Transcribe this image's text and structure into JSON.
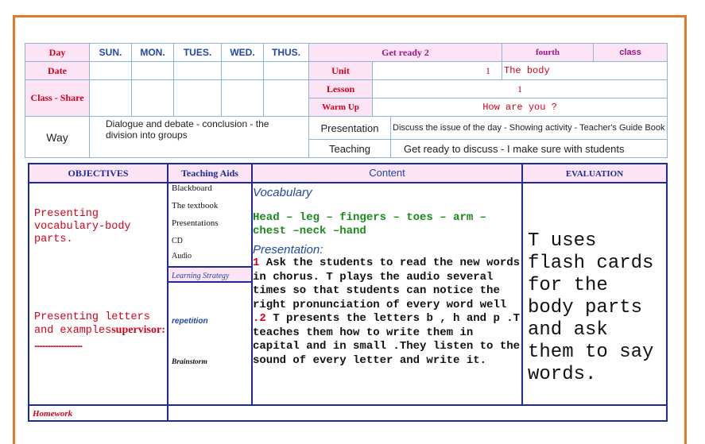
{
  "header": {
    "day_label": "Day",
    "days": [
      "SUN.",
      "MON.",
      "TUES.",
      "WED.",
      "THUS."
    ],
    "title": "Get ready 2",
    "level": "fourth",
    "class_label": "class",
    "date_label": "Date",
    "unit_label": "Unit",
    "unit_number": "1",
    "unit_name": "The body",
    "class_share_label": "Class - Share",
    "lesson_label": "Lesson",
    "lesson_number": "1",
    "warmup_label": "Warm Up",
    "warmup_text": "How are you ?",
    "way_label": "Way",
    "way_text": "Dialogue and debate - conclusion - the division into groups",
    "presentation_label": "Presentation",
    "presentation_text": "Discuss the issue of the day - Showing activity - Teacher's Guide Book",
    "teaching_label": "Teaching",
    "teaching_text": "Get ready to discuss - I make sure with students"
  },
  "table": {
    "col_objectives": "OBJECTIVES",
    "col_aids": "Teaching Aids",
    "col_content": "Content",
    "col_eval": "EVALUATION",
    "objective_1": "Presenting vocabulary-body parts.",
    "objective_2_text": "Presenting letters and examples",
    "objective_2_supervisor": "supervisor:",
    "objective_2_dots": "..............................",
    "aids": [
      "Blackboard",
      "The textbook",
      "Presentations",
      "CD",
      "Audio"
    ],
    "learning_strategy": "Learning Strategy",
    "strategy_1": "repetition",
    "strategy_2": "Brainstorm",
    "vocab_heading": "Vocabulary",
    "vocab_words": "Head – leg – fingers – toes – arm – chest –neck –hand",
    "presentation_heading": "Presentation:",
    "step_1_num": "1",
    "step_1_text": " Ask the students to read  the new words in chorus. T plays the audio several times so that students can notice the right pronunciation of every word  well",
    "step_2_num": ".2",
    "step_2_text": " T presents the letters  b ,  h  and p .T teaches them how to write them in capital and in small .They listen to the sound of every letter and write it.",
    "evaluation": "T uses flash cards for the body parts and ask them to say words.",
    "homework_label": "Homework"
  }
}
